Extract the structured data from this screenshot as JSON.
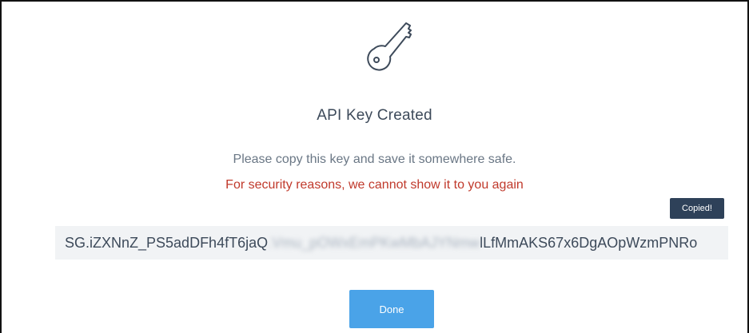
{
  "dialog": {
    "icon": "key-icon",
    "title": "API Key Created",
    "subtitle": "Please copy this key and save it somewhere safe.",
    "warning": "For security reasons, we cannot show it to you again",
    "tooltip": "Copied!",
    "api_key": {
      "visible_start": "SG.iZXNnZ_PS5adDFh4fT6jaQ",
      "blurred_middle": ".Vmu_pOWxEmPKwMbAJYNmw",
      "visible_end": "lLfMmAKS67x6DgAOpWzmPNRo"
    },
    "done_label": "Done"
  },
  "colors": {
    "title": "#3d4a5a",
    "warning": "#c0392b",
    "tooltip_bg": "#2e4159",
    "button_bg": "#4aa3e8",
    "key_box_bg": "#f1f3f5"
  }
}
